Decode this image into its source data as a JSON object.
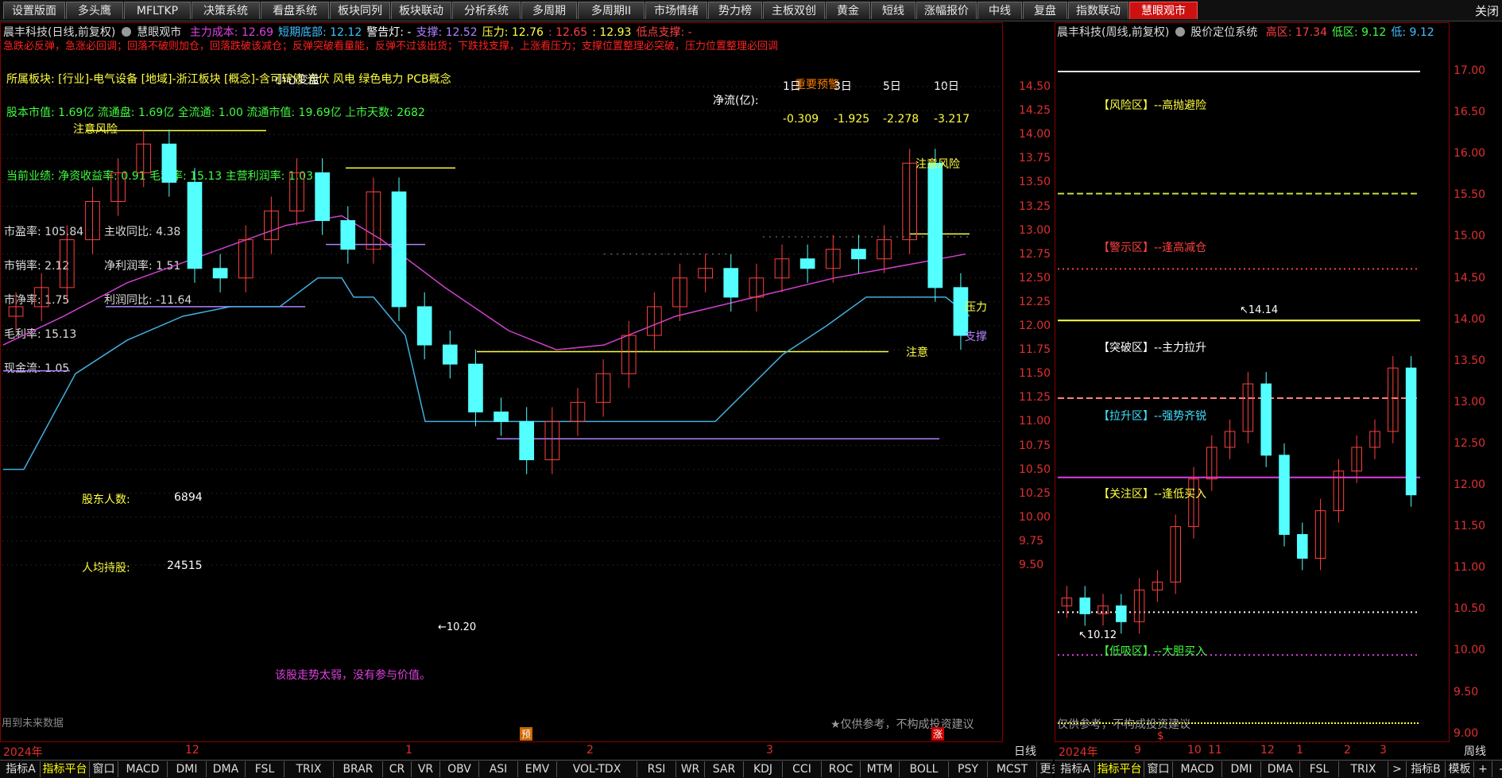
{
  "tabs": [
    "设置版面",
    "多头鹰",
    "MFLTKP",
    "决策系统",
    "看盘系统",
    "板块同列",
    "板块联动",
    "分析系统",
    "多周期",
    "多周期II",
    "市场情绪",
    "势力榜",
    "主板双创",
    "黄金",
    "短线",
    "涨幅报价",
    "中线",
    "复盘",
    "指数联动",
    "慧眼观市"
  ],
  "close_label": "关闭",
  "left": {
    "header": {
      "title": "晨丰科技(日线,前复权)",
      "system": "慧眼观市",
      "items": [
        {
          "label": "主力成本: 12.69",
          "color": "#e040e0"
        },
        {
          "label": "短期底部: 12.12",
          "color": "#40c0ff"
        },
        {
          "label": "警告灯: -",
          "color": "#ffffff"
        },
        {
          "label": "支撑: 12.52",
          "color": "#b080ff"
        },
        {
          "label": "压力: 12.76",
          "color": "#ffff40"
        },
        {
          "label": ": 12.65",
          "color": "#ff4040"
        },
        {
          "label": ": 12.93",
          "color": "#ffff40"
        },
        {
          "label": "低点支撑: -",
          "color": "#ff4040"
        }
      ],
      "slogan": "急跌必反弹，急涨必回调；回落不破则加仓，回落跌破该减仓；反弹突破看量能，反弹不过该出货；下跌找支撑，上涨看压力；支撑位置整理必突破，压力位置整理必回调"
    },
    "sector": "所属板块: [行业]-电气设备 [地域]-浙江板块 [概念]-含可转债 光伏 风电 绿色电力 PCB概念",
    "share_info": "股本市值: 1.69亿 流通盘: 1.69亿 全流通: 1.00 流通市值: 19.69亿 上市天数: 2682",
    "perf": "当前业绩: 净资收益率: 0.91 毛利率: 15.13 主营利润率: 1.03",
    "xiaoxin": "小心变盘",
    "alert_label": "重要预警",
    "flow": {
      "label": "净流(亿):",
      "periods": [
        "1日",
        "3日",
        "5日",
        "10日"
      ],
      "values": [
        "-0.309",
        "-1.925",
        "-2.278",
        "-3.217"
      ]
    },
    "fund_items": [
      {
        "label": "市盈率: 105.84"
      },
      {
        "label": "主收同比: 4.38"
      },
      {
        "label": "市销率: 2.12"
      },
      {
        "label": "净利润率: 1.51"
      },
      {
        "label": "市净率: 1.75"
      },
      {
        "label": "利润同比: -11.64"
      },
      {
        "label": "毛利率: 15.13"
      },
      {
        "label": "现金流: 1.05"
      }
    ],
    "holders_label": "股东人数:",
    "holders_value": "6894",
    "avg_label": "人均持股:",
    "avg_value": "24515",
    "weak_note": "该股走势太弱，没有参与价值。",
    "future_note": "用到未来数据",
    "disclaimer": "★仅供参考，不构成投资建议",
    "notes": {
      "risk": "注意风险",
      "risk2": "注意风险",
      "pressure": "压力",
      "support": "支撑",
      "attention": "注意",
      "low": "10.20"
    },
    "y_axis": [
      "14.50",
      "14.25",
      "14.00",
      "13.75",
      "13.50",
      "13.25",
      "13.00",
      "12.75",
      "12.50",
      "12.25",
      "12.00",
      "11.75",
      "11.50",
      "11.25",
      "11.00",
      "10.75",
      "10.50",
      "10.25",
      "10.00",
      "9.75",
      "9.50"
    ],
    "x_axis": [
      "2024年",
      "12",
      "1",
      "2",
      "3"
    ],
    "period": "日线",
    "yu": "预",
    "zhang": "涨"
  },
  "right": {
    "header": {
      "title": "晨丰科技(周线,前复权)",
      "system": "股价定位系统",
      "items": [
        {
          "label": "高区: 17.34",
          "color": "#ff4040"
        },
        {
          "label": "低区: 9.12",
          "color": "#40ff40"
        },
        {
          "label": "低: 9.12",
          "color": "#40c0ff"
        }
      ]
    },
    "zones": [
      {
        "label": "【风险区】--高抛避险",
        "color": "#ffff40"
      },
      {
        "label": "【警示区】--逢高减仓",
        "color": "#ff4040"
      },
      {
        "label": "【突破区】--主力拉升",
        "color": "#ffffff"
      },
      {
        "label": "【拉升区】--强势齐锐",
        "color": "#40e0ff"
      },
      {
        "label": "【关注区】--逢低买入",
        "color": "#ffff40"
      },
      {
        "label": "【低吸区】--大胆买入",
        "color": "#40ff40"
      }
    ],
    "high_mark": "14.14",
    "low_mark": "10.12",
    "disclaimer": "仅供参考，不构成投资建议",
    "y_axis": [
      "17.00",
      "16.50",
      "16.00",
      "15.50",
      "15.00",
      "14.50",
      "14.00",
      "13.50",
      "13.00",
      "12.50",
      "12.00",
      "11.50",
      "11.00",
      "10.50",
      "10.00",
      "9.50",
      "9.00"
    ],
    "x_axis": [
      "2024年",
      "9",
      "10",
      "11",
      "12",
      "1",
      "2",
      "3"
    ],
    "period": "周线",
    "s": "$"
  },
  "bottom_left": [
    "指标A",
    "指标平台",
    "窗口",
    "MACD",
    "DMI",
    "DMA",
    "FSL",
    "TRIX",
    "BRAR",
    "CR",
    "VR",
    "OBV",
    "ASI",
    "EMV",
    "VOL-TDX",
    "RSI",
    "WR",
    "SAR",
    "KDJ",
    "CCI",
    "ROC",
    "MTM",
    "BOLL",
    "PSY",
    "MCST",
    "更多",
    ">",
    "指标B",
    "模板",
    "+",
    "-",
    "0"
  ],
  "bottom_right": [
    "指标A",
    "指标平台",
    "窗口",
    "MACD",
    "DMI",
    "DMA",
    "FSL",
    "TRIX",
    ">",
    "指标B",
    "模板",
    "+",
    "-"
  ],
  "chart_data": [
    {
      "type": "candlestick",
      "title": "晨丰科技(日线,前复权)",
      "ylim": [
        9.5,
        14.5
      ],
      "x_ticks": [
        "2024年",
        "12",
        "1",
        "2",
        "3"
      ],
      "close_approx": [
        12.2,
        12.4,
        12.9,
        13.3,
        13.6,
        13.9,
        13.5,
        12.6,
        12.5,
        12.9,
        13.2,
        13.6,
        13.1,
        12.8,
        13.4,
        12.2,
        11.8,
        11.6,
        11.1,
        11.0,
        10.6,
        11.0,
        11.2,
        11.5,
        11.9,
        12.2,
        12.5,
        12.6,
        12.3,
        12.5,
        12.7,
        12.6,
        12.8,
        12.7,
        12.9,
        13.7,
        12.4,
        11.9
      ]
    },
    {
      "type": "candlestick",
      "title": "晨丰科技(周线,前复权)",
      "ylim": [
        9.0,
        17.0
      ],
      "x_ticks": [
        "2024年",
        "9",
        "10",
        "11",
        "12",
        "1",
        "2",
        "3"
      ],
      "close_approx": [
        10.7,
        10.5,
        10.6,
        10.4,
        10.8,
        10.9,
        11.6,
        12.2,
        12.6,
        12.8,
        13.4,
        12.5,
        11.5,
        11.2,
        11.8,
        12.3,
        12.6,
        12.8,
        13.6,
        12.0
      ]
    }
  ]
}
